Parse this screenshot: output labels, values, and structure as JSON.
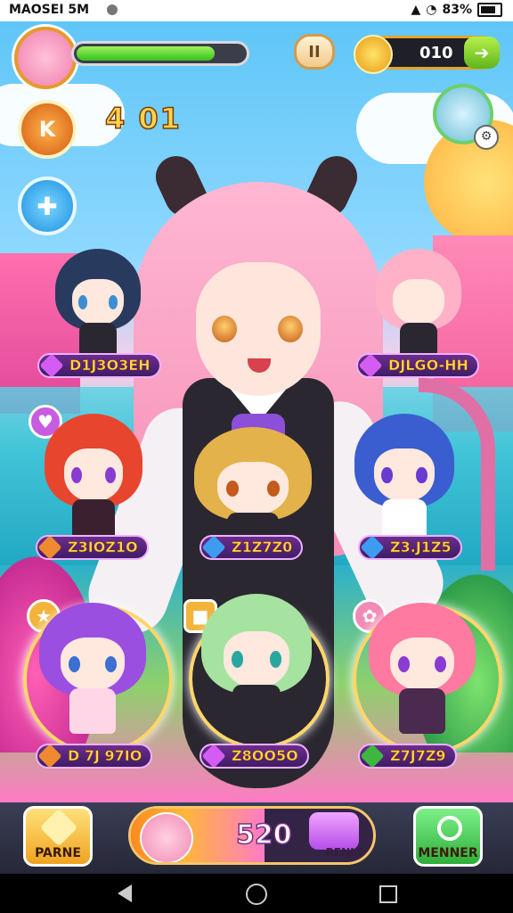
{
  "status_bar": {
    "left_text": "MAOSEI 5M",
    "battery": "83%"
  },
  "hud": {
    "health_fraction": 0.83,
    "pause_label": "II",
    "coins": "010",
    "coin_add_label": "➔",
    "level_badge_text": "K",
    "score": "4 01",
    "side_button_icon": "puzzle-icon",
    "friend_gear": "⚙"
  },
  "characters": [
    {
      "name_tag": "D1J3O3EH",
      "gem_color": "#d55cf2",
      "hair": "#283a5e",
      "outfit": "#2b2730"
    },
    {
      "name_tag": "DJLGO-HH",
      "gem_color": "#d55cf2",
      "hair": "#ffb1c8",
      "outfit": "#2b2730"
    },
    {
      "name_tag": "Z3IOZ1O",
      "gem_color": "#f08a30",
      "hair": "#e8452e",
      "outfit": "#3b2130"
    },
    {
      "name_tag": "Z1Z7Z0",
      "gem_color": "#3d9cf0",
      "hair": "#e4b24a",
      "outfit": "#2b2730"
    },
    {
      "name_tag": "Z3.J1Z5",
      "gem_color": "#3d9cf0",
      "hair": "#3a5ed0",
      "outfit": "#ffffff"
    },
    {
      "name_tag": "D 7J 97IO",
      "gem_color": "#f08a30",
      "hair": "#9b4fe0",
      "outfit": "#ffd6e6"
    },
    {
      "name_tag": "Z8OO5O",
      "gem_color": "#d55cf2",
      "hair": "#a6e3a0",
      "outfit": "#2b2730"
    },
    {
      "name_tag": "Z7J7Z9",
      "gem_color": "#3fb640",
      "hair": "#ff7aa0",
      "outfit": "#4b2a50"
    }
  ],
  "bottom_bar": {
    "left_button": "PARNE",
    "energy_value": "520",
    "energy_fraction": 0.55,
    "energy_label": "RENLE",
    "right_button": "MENNER"
  },
  "colors": {
    "accent": "#f7c56a",
    "health": "#33c11e"
  }
}
